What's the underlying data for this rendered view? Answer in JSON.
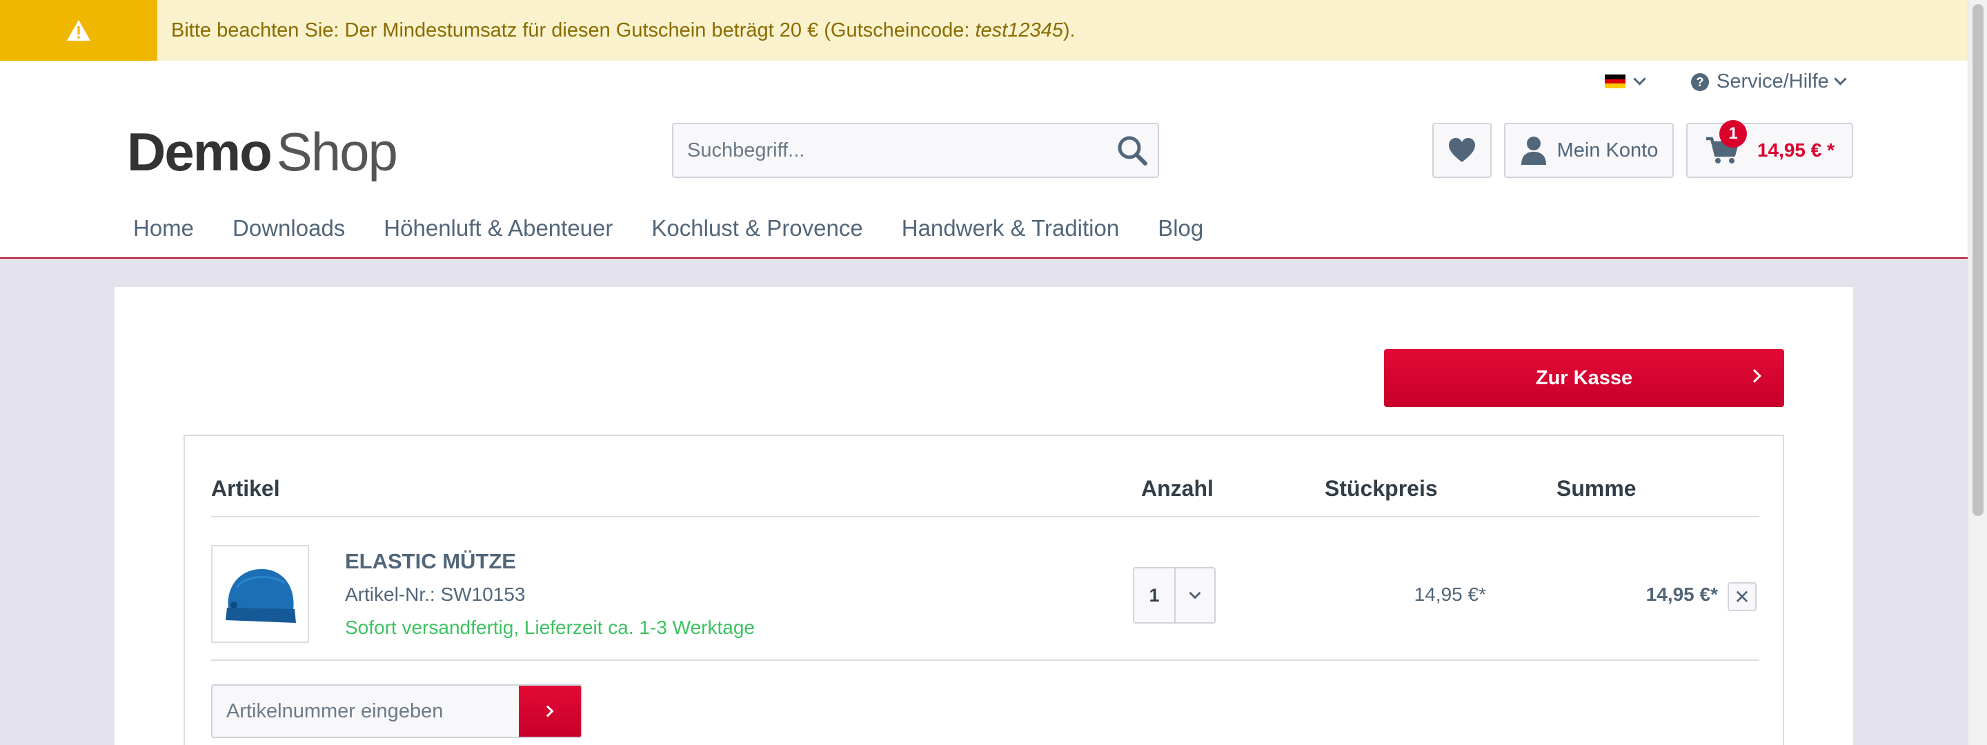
{
  "notice": {
    "text_before": "Bitte beachten Sie: Der Mindestumsatz für diesen Gutschein beträgt 20 € (Gutscheincode: ",
    "code": "test12345",
    "text_after": ")."
  },
  "topbar": {
    "service_label": "Service/Hilfe"
  },
  "logo": {
    "bold": "Demo",
    "light": "Shop"
  },
  "search": {
    "placeholder": "Suchbegriff..."
  },
  "header_actions": {
    "account_label": "Mein Konto",
    "cart_count": "1",
    "cart_total": "14,95 € *"
  },
  "nav": {
    "items": [
      "Home",
      "Downloads",
      "Höhenluft & Abenteuer",
      "Kochlust & Provence",
      "Handwerk & Tradition",
      "Blog"
    ]
  },
  "checkout": {
    "button_label": "Zur Kasse"
  },
  "cart_table": {
    "headers": {
      "article": "Artikel",
      "quantity": "Anzahl",
      "unit_price": "Stückpreis",
      "sum": "Summe"
    },
    "rows": [
      {
        "name": "ELASTIC MÜTZE",
        "article_number": "Artikel-Nr.: SW10153",
        "delivery": "Sofort versandfertig, Lieferzeit ca. 1-3 Werktage",
        "quantity": "1",
        "unit_price": "14,95 €*",
        "sum": "14,95 €*"
      }
    ],
    "remove_glyph": "✕"
  },
  "add_article": {
    "placeholder": "Artikelnummer eingeben"
  },
  "colors": {
    "accent": "#d9002c",
    "notice_bg": "#f9f2cc",
    "notice_icon_bg": "#efb700",
    "delivery_green": "#3cc261",
    "page_bg": "#e4e2ec"
  },
  "icons": [
    "warning-icon",
    "flag-de-icon",
    "help-circle-icon",
    "search-icon",
    "heart-icon",
    "user-icon",
    "cart-icon",
    "chevron-right-icon",
    "chevron-down-icon",
    "close-icon"
  ]
}
